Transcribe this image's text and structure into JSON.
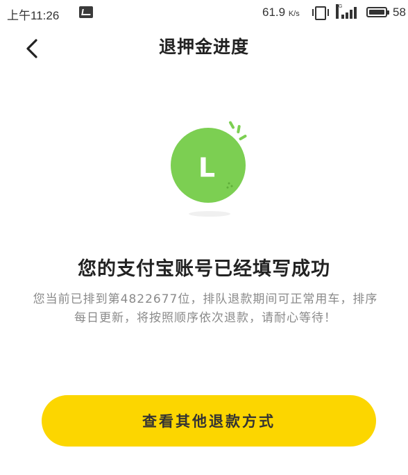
{
  "status_bar": {
    "time": "上午11:26",
    "net_speed": "61.9",
    "net_unit": "K/s",
    "network_label": "4G",
    "battery": "58"
  },
  "header": {
    "title": "退押金进度"
  },
  "main": {
    "illustration_letter": "L",
    "headline": "您的支付宝账号已经填写成功",
    "description_lines": [
      "您当前已排到第4822677位，排队退款期间可正常用车，排序",
      "每日更新，将按照顺序依次退款，请耐心等待！"
    ],
    "cta_label": "查看其他退款方式"
  },
  "colors": {
    "accent_yellow": "#fcd600",
    "clock_green": "#7ccf52",
    "text_dark": "#222222",
    "text_gray": "#8a8a8a"
  }
}
